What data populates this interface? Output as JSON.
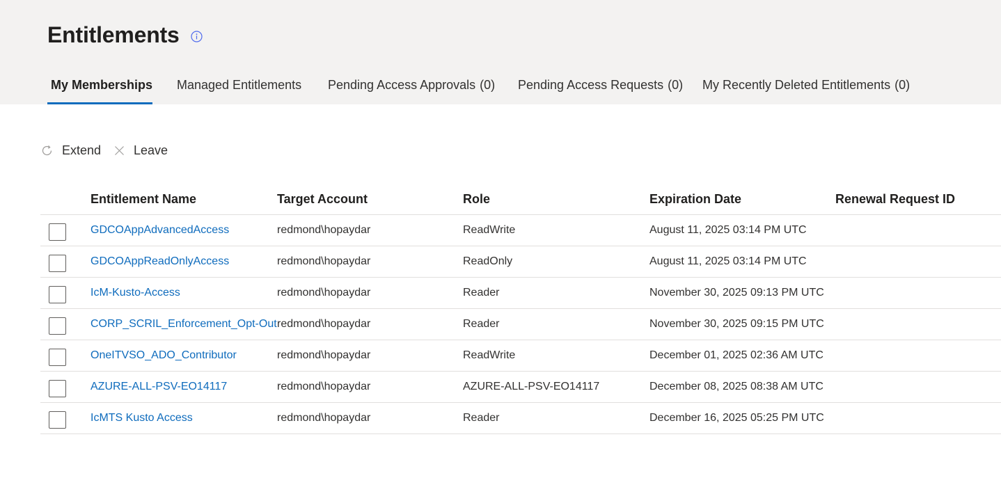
{
  "page": {
    "title": "Entitlements",
    "info_icon": "info-icon"
  },
  "tabs": [
    {
      "label": "My Memberships",
      "count": "",
      "active": true
    },
    {
      "label": "Managed Entitlements",
      "count": "",
      "active": false
    },
    {
      "label": "Pending Access Approvals",
      "count": "(0)",
      "active": false
    },
    {
      "label": "Pending Access Requests",
      "count": "(0)",
      "active": false
    },
    {
      "label": "My Recently Deleted Entitlements",
      "count": "(0)",
      "active": false
    }
  ],
  "toolbar": {
    "extend_label": "Extend",
    "extend_icon": "refresh-icon",
    "leave_label": "Leave",
    "leave_icon": "close-icon"
  },
  "table": {
    "columns": [
      "Entitlement Name",
      "Target Account",
      "Role",
      "Expiration Date",
      "Renewal Request ID"
    ],
    "rows": [
      {
        "name": "GDCOAppAdvancedAccess",
        "account": "redmond\\hopaydar",
        "role": "ReadWrite",
        "expiration": "August 11, 2025 03:14 PM UTC",
        "renewal_id": ""
      },
      {
        "name": "GDCOAppReadOnlyAccess",
        "account": "redmond\\hopaydar",
        "role": "ReadOnly",
        "expiration": "August 11, 2025 03:14 PM UTC",
        "renewal_id": ""
      },
      {
        "name": "IcM-Kusto-Access",
        "account": "redmond\\hopaydar",
        "role": "Reader",
        "expiration": "November 30, 2025 09:13 PM UTC",
        "renewal_id": ""
      },
      {
        "name": "CORP_SCRIL_Enforcement_Opt-Out",
        "account": "redmond\\hopaydar",
        "role": "Reader",
        "expiration": "November 30, 2025 09:15 PM UTC",
        "renewal_id": ""
      },
      {
        "name": "OneITVSO_ADO_Contributor",
        "account": "redmond\\hopaydar",
        "role": "ReadWrite",
        "expiration": "December 01, 2025 02:36 AM UTC",
        "renewal_id": ""
      },
      {
        "name": "AZURE-ALL-PSV-EO14117",
        "account": "redmond\\hopaydar",
        "role": "AZURE-ALL-PSV-EO14117",
        "expiration": "December 08, 2025 08:38 AM UTC",
        "renewal_id": ""
      },
      {
        "name": "IcMTS Kusto Access",
        "account": "redmond\\hopaydar",
        "role": "Reader",
        "expiration": "December 16, 2025 05:25 PM UTC",
        "renewal_id": ""
      }
    ]
  },
  "colors": {
    "header_bg": "#f3f2f1",
    "accent": "#0f6cbd",
    "link": "#0f6cbd",
    "divider": "#e1dfdd"
  }
}
